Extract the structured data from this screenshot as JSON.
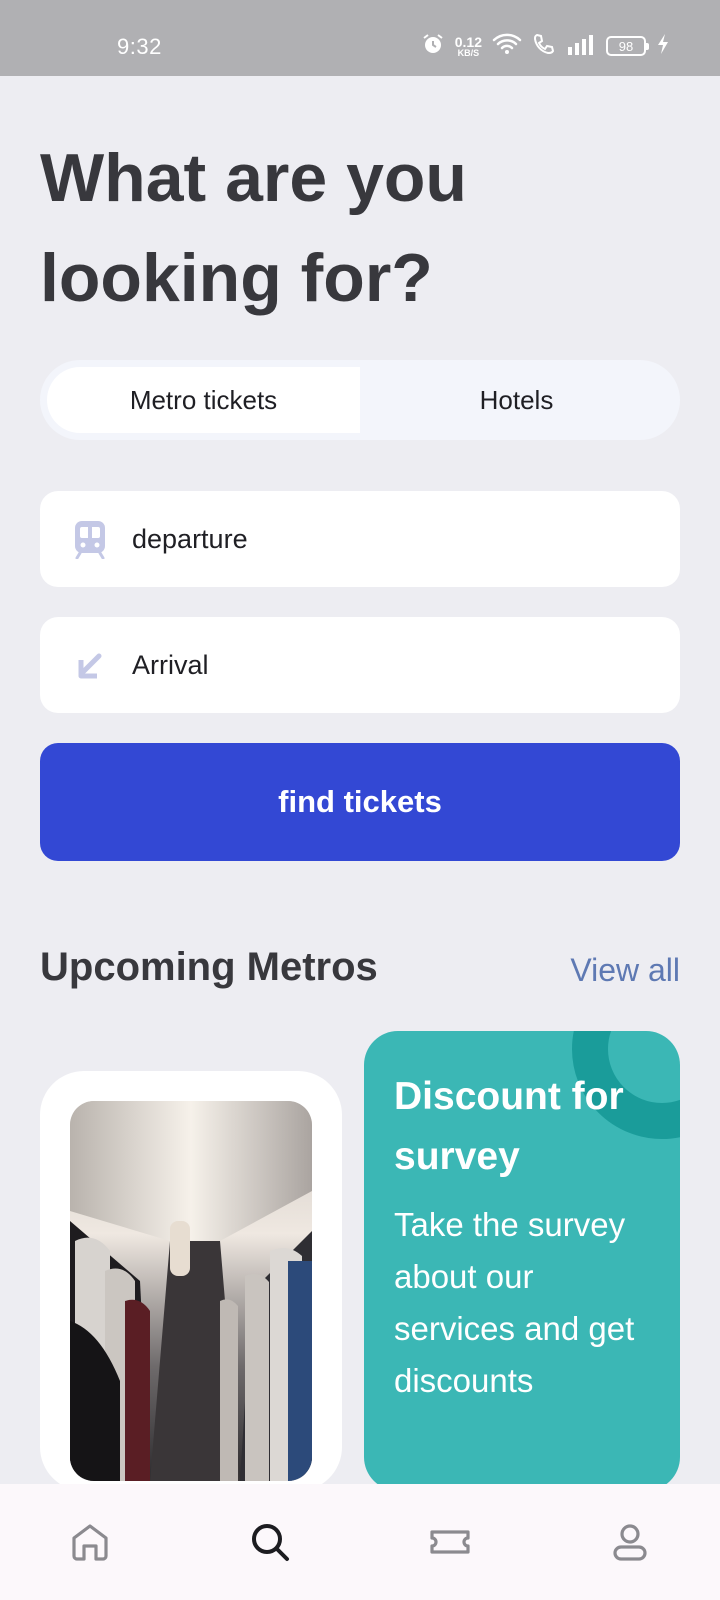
{
  "status_bar": {
    "time": "9:32",
    "net_speed_value": "0.12",
    "net_speed_unit": "KB/S",
    "battery": "98"
  },
  "headline": "What are you looking for?",
  "tabs": [
    {
      "label": "Metro tickets",
      "active": true
    },
    {
      "label": "Hotels",
      "active": false
    }
  ],
  "departure": {
    "placeholder": "departure",
    "icon": "train-icon"
  },
  "arrival": {
    "placeholder": "Arrival",
    "icon": "arrow-down-left-icon"
  },
  "find_button": "find tickets",
  "upcoming": {
    "title": "Upcoming Metros",
    "view_all": "View all"
  },
  "survey_card": {
    "title": "Discount for survey",
    "text": "Take the survey about our services and get discounts"
  },
  "nav": [
    "home-icon",
    "search-icon",
    "ticket-icon",
    "profile-icon"
  ],
  "colors": {
    "accent": "#3348d4",
    "teal": "#3bb7b5",
    "link": "#5e79b3",
    "heading": "#38383d"
  }
}
